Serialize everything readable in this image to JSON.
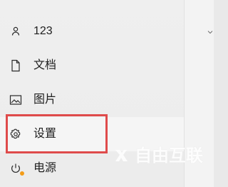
{
  "menu": {
    "items": [
      {
        "label": "123",
        "icon": "user-icon"
      },
      {
        "label": "文档",
        "icon": "document-icon"
      },
      {
        "label": "图片",
        "icon": "image-icon"
      },
      {
        "label": "设置",
        "icon": "gear-icon"
      },
      {
        "label": "电源",
        "icon": "power-icon"
      }
    ]
  },
  "right_pane": {
    "chevron_icon": "chevron-down-icon"
  },
  "watermark": {
    "text": "自由互联",
    "logo_icon": "x-logo-icon"
  },
  "colors": {
    "highlight_border": "#df4b4b",
    "battery_accent": "#f39c18"
  }
}
